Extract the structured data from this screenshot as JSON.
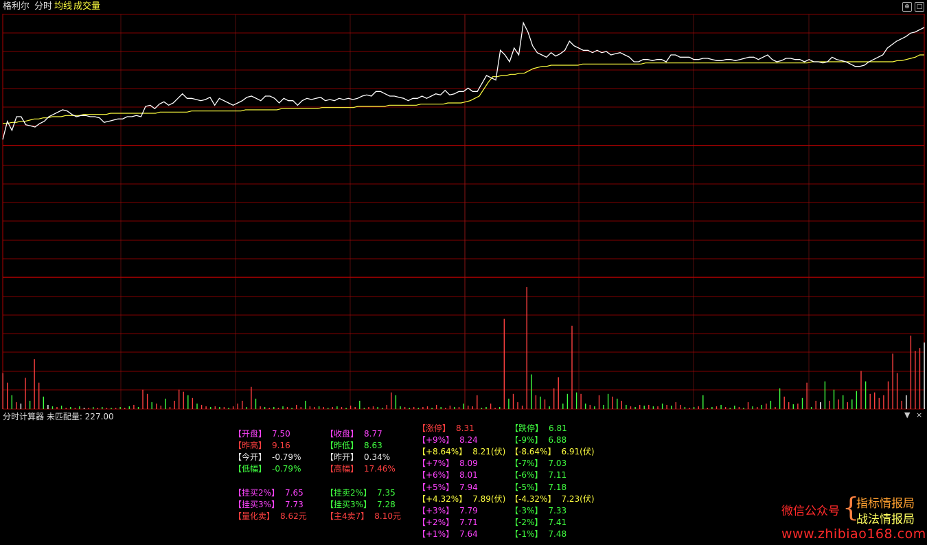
{
  "header": {
    "stock_name": "格利尔",
    "mode": "分时",
    "indicators": [
      "均线",
      "成交量"
    ]
  },
  "window_controls": [
    "⊕",
    "□"
  ],
  "colors": {
    "grid": "#b00000",
    "price_line": "#ffffff",
    "avg_line": "#ffff40",
    "up_bar": "#ff4040",
    "down_bar": "#40ff40",
    "flat_bar": "#ffffff"
  },
  "calculator": {
    "title": "分时计算器 未匹配量: 227.00",
    "block1": {
      "left": [
        {
          "k": "【开盘】",
          "v": "7.50",
          "c": "mag",
          "vc": "mag"
        },
        {
          "k": "【昨高】",
          "v": "9.16",
          "c": "red",
          "vc": "red"
        },
        {
          "k": "【今开】",
          "v": "-0.79%",
          "c": "wht",
          "vc": "wht"
        },
        {
          "k": "【低幅】",
          "v": "-0.79%",
          "c": "grn",
          "vc": "grn"
        }
      ],
      "right": [
        {
          "k": "【收盘】",
          "v": "8.77",
          "c": "mag",
          "vc": "mag"
        },
        {
          "k": "【昨低】",
          "v": "8.63",
          "c": "grn",
          "vc": "grn"
        },
        {
          "k": "【昨开】",
          "v": "0.34%",
          "c": "wht",
          "vc": "wht"
        },
        {
          "k": "【高幅】",
          "v": "17.46%",
          "c": "red",
          "vc": "red"
        }
      ]
    },
    "block2": {
      "left": [
        {
          "k": "【挂买2%】",
          "v": "7.65",
          "c": "mag",
          "vc": "mag"
        },
        {
          "k": "【挂买3%】",
          "v": "7.73",
          "c": "mag",
          "vc": "mag"
        },
        {
          "k": "【量化卖】",
          "v": "8.62元",
          "c": "red",
          "vc": "red"
        }
      ],
      "right": [
        {
          "k": "【挂卖2%】",
          "v": "7.35",
          "c": "grn",
          "vc": "grn"
        },
        {
          "k": "【挂买3%】",
          "v": "7.28",
          "c": "grn",
          "vc": "grn"
        },
        {
          "k": "【主4卖7】",
          "v": "8.10元",
          "c": "red",
          "vc": "red"
        }
      ]
    },
    "up_levels": [
      {
        "k": "【涨停】",
        "v": "8.31",
        "c": "red",
        "vc": "red"
      },
      {
        "k": "【+9%】",
        "v": "8.24",
        "c": "mag",
        "vc": "mag"
      },
      {
        "k": "【+8.64%】",
        "v": "8.21(伏)",
        "c": "yel",
        "vc": "yel"
      },
      {
        "k": "【+7%】",
        "v": "8.09",
        "c": "mag",
        "vc": "mag"
      },
      {
        "k": "【+6%】",
        "v": "8.01",
        "c": "mag",
        "vc": "mag"
      },
      {
        "k": "【+5%】",
        "v": "7.94",
        "c": "mag",
        "vc": "mag"
      },
      {
        "k": "【+4.32%】",
        "v": "7.89(伏)",
        "c": "yel",
        "vc": "yel"
      },
      {
        "k": "【+3%】",
        "v": "7.79",
        "c": "mag",
        "vc": "mag"
      },
      {
        "k": "【+2%】",
        "v": "7.71",
        "c": "mag",
        "vc": "mag"
      },
      {
        "k": "【+1%】",
        "v": "7.64",
        "c": "mag",
        "vc": "mag"
      }
    ],
    "down_levels": [
      {
        "k": "【跌停】",
        "v": "6.81",
        "c": "grn",
        "vc": "grn"
      },
      {
        "k": "【-9%】",
        "v": "6.88",
        "c": "grn",
        "vc": "grn"
      },
      {
        "k": "【-8.64%】",
        "v": "6.91(伏)",
        "c": "yel",
        "vc": "yel"
      },
      {
        "k": "【-7%】",
        "v": "7.03",
        "c": "grn",
        "vc": "grn"
      },
      {
        "k": "【-6%】",
        "v": "7.11",
        "c": "grn",
        "vc": "grn"
      },
      {
        "k": "【-5%】",
        "v": "7.18",
        "c": "grn",
        "vc": "grn"
      },
      {
        "k": "【-4.32%】",
        "v": "7.23(伏)",
        "c": "yel",
        "vc": "yel"
      },
      {
        "k": "【-3%】",
        "v": "7.33",
        "c": "grn",
        "vc": "grn"
      },
      {
        "k": "【-2%】",
        "v": "7.41",
        "c": "grn",
        "vc": "grn"
      },
      {
        "k": "【-1%】",
        "v": "7.48",
        "c": "grn",
        "vc": "grn"
      }
    ],
    "controls": [
      "▼",
      "×"
    ]
  },
  "watermark": {
    "wechat": "微信公众号",
    "brace": "{",
    "line1": "指标情报局",
    "line2": "战法情报局",
    "url": "www.zhibiao168.com"
  },
  "chart_data": {
    "type": "line",
    "series": [
      {
        "values": [
          7.5,
          7.66,
          7.58,
          7.7,
          7.7,
          7.63,
          7.62,
          7.61,
          7.64,
          7.66,
          7.7,
          7.72,
          7.74,
          7.76,
          7.75,
          7.72,
          7.7,
          7.71,
          7.71,
          7.7,
          7.7,
          7.69,
          7.65,
          7.66,
          7.67,
          7.68,
          7.68,
          7.7,
          7.7,
          7.71,
          7.7,
          7.79,
          7.8,
          7.77,
          7.81,
          7.83,
          7.8,
          7.82,
          7.86,
          7.9,
          7.86,
          7.86,
          7.85,
          7.84,
          7.85,
          7.87,
          7.8,
          7.86,
          7.84,
          7.82,
          7.8,
          7.82,
          7.84,
          7.87,
          7.88,
          7.86,
          7.84,
          7.88,
          7.88,
          7.86,
          7.82,
          7.86,
          7.84,
          7.84,
          7.8,
          7.84,
          7.86,
          7.85,
          7.86,
          7.87,
          7.84,
          7.85,
          7.84,
          7.86,
          7.85,
          7.86,
          7.85,
          7.86,
          7.88,
          7.89,
          7.88,
          7.92,
          7.92,
          7.9,
          7.88,
          7.88,
          7.87,
          7.86,
          7.84,
          7.86,
          7.86,
          7.88,
          7.86,
          7.88,
          7.9,
          7.89,
          7.93,
          7.89,
          7.9,
          7.92,
          7.92,
          7.95,
          7.92,
          7.92,
          7.99,
          8.06,
          8.04,
          8.02,
          8.28,
          8.24,
          8.18,
          8.3,
          8.24,
          8.52,
          8.44,
          8.32,
          8.26,
          8.24,
          8.22,
          8.26,
          8.23,
          8.25,
          8.28,
          8.36,
          8.32,
          8.3,
          8.28,
          8.28,
          8.26,
          8.28,
          8.26,
          8.27,
          8.24,
          8.25,
          8.26,
          8.24,
          8.22,
          8.18,
          8.18,
          8.2,
          8.2,
          8.19,
          8.2,
          8.2,
          8.18,
          8.24,
          8.24,
          8.22,
          8.22,
          8.22,
          8.2,
          8.2,
          8.21,
          8.21,
          8.2,
          8.19,
          8.19,
          8.2,
          8.2,
          8.19,
          8.2,
          8.21,
          8.22,
          8.22,
          8.2,
          8.22,
          8.24,
          8.2,
          8.18,
          8.19,
          8.21,
          8.21,
          8.2,
          8.2,
          8.18,
          8.2,
          8.18,
          8.18,
          8.17,
          8.18,
          8.22,
          8.2,
          8.19,
          8.18,
          8.16,
          8.14,
          8.14,
          8.15,
          8.18,
          8.2,
          8.22,
          8.24,
          8.3,
          8.33,
          8.36,
          8.38,
          8.4,
          8.43,
          8.44,
          8.46,
          8.48
        ]
      },
      {
        "values": [
          7.64,
          7.64,
          7.65,
          7.65,
          7.66,
          7.66,
          7.67,
          7.68,
          7.68,
          7.69,
          7.69,
          7.7,
          7.7,
          7.7,
          7.71,
          7.71,
          7.71,
          7.71,
          7.72,
          7.72,
          7.72,
          7.72,
          7.72,
          7.72,
          7.73,
          7.73,
          7.73,
          7.73,
          7.73,
          7.73,
          7.73,
          7.73,
          7.73,
          7.73,
          7.73,
          7.74,
          7.74,
          7.74,
          7.74,
          7.74,
          7.74,
          7.74,
          7.75,
          7.75,
          7.75,
          7.75,
          7.75,
          7.75,
          7.75,
          7.75,
          7.75,
          7.75,
          7.75,
          7.75,
          7.76,
          7.76,
          7.76,
          7.76,
          7.76,
          7.76,
          7.76,
          7.76,
          7.77,
          7.77,
          7.77,
          7.77,
          7.77,
          7.77,
          7.77,
          7.77,
          7.77,
          7.78,
          7.78,
          7.78,
          7.78,
          7.78,
          7.78,
          7.78,
          7.78,
          7.79,
          7.79,
          7.79,
          7.79,
          7.79,
          7.79,
          7.79,
          7.8,
          7.8,
          7.8,
          7.8,
          7.8,
          7.8,
          7.8,
          7.81,
          7.81,
          7.81,
          7.81,
          7.81,
          7.81,
          7.82,
          7.82,
          7.82,
          7.82,
          7.83,
          7.84,
          7.86,
          7.88,
          7.94,
          8.0,
          8.05,
          8.05,
          8.06,
          8.06,
          8.07,
          8.07,
          8.08,
          8.08,
          8.1,
          8.12,
          8.13,
          8.14,
          8.14,
          8.15,
          8.15,
          8.15,
          8.15,
          8.15,
          8.15,
          8.15,
          8.16,
          8.16,
          8.16,
          8.16,
          8.16,
          8.16,
          8.16,
          8.16,
          8.16,
          8.16,
          8.16,
          8.16,
          8.16,
          8.16,
          8.17,
          8.17,
          8.17,
          8.17,
          8.17,
          8.17,
          8.17,
          8.17,
          8.17,
          8.17,
          8.17,
          8.17,
          8.17,
          8.17,
          8.17,
          8.17,
          8.17,
          8.17,
          8.17,
          8.17,
          8.17,
          8.17,
          8.17,
          8.17,
          8.17,
          8.17,
          8.17,
          8.17,
          8.17,
          8.17,
          8.17,
          8.17,
          8.17,
          8.17,
          8.17,
          8.17,
          8.17,
          8.18,
          8.18,
          8.18,
          8.18,
          8.18,
          8.18,
          8.18,
          8.18,
          8.18,
          8.18,
          8.18,
          8.18,
          8.18,
          8.18,
          8.18,
          8.18,
          8.18,
          8.18,
          8.18,
          8.19,
          8.19,
          8.2,
          8.21,
          8.22,
          8.24,
          8.24
        ]
      }
    ],
    "ylim": [
      7.4,
      8.6
    ],
    "volume": {
      "values": [
        52,
        38,
        20,
        10,
        8,
        45,
        12,
        72,
        38,
        18,
        6,
        4,
        3,
        5,
        2,
        3,
        2,
        4,
        2,
        2,
        3,
        2,
        3,
        2,
        2,
        2,
        3,
        2,
        4,
        6,
        3,
        28,
        22,
        10,
        8,
        5,
        15,
        3,
        12,
        28,
        25,
        20,
        16,
        8,
        6,
        4,
        3,
        4,
        3,
        3,
        2,
        4,
        8,
        12,
        3,
        32,
        15,
        4,
        3,
        2,
        3,
        2,
        4,
        3,
        2,
        6,
        3,
        12,
        4,
        3,
        4,
        3,
        2,
        3,
        4,
        3,
        2,
        5,
        3,
        12,
        2,
        3,
        4,
        3,
        2,
        6,
        24,
        20,
        4,
        3,
        2,
        3,
        2,
        3,
        4,
        2,
        6,
        3,
        2,
        5,
        3,
        3,
        8,
        5,
        4,
        20,
        2,
        3,
        8,
        2,
        3,
        130,
        15,
        22,
        10,
        5,
        176,
        50,
        20,
        18,
        14,
        4,
        30,
        46,
        8,
        22,
        120,
        24,
        22,
        8,
        6,
        4,
        20,
        6,
        22,
        18,
        15,
        12,
        6,
        4,
        3,
        6,
        5,
        6,
        4,
        4,
        8,
        6,
        5,
        10,
        6,
        3,
        2,
        3,
        4,
        20,
        2,
        3,
        4,
        6,
        3,
        2,
        5,
        3,
        2,
        10,
        4,
        3,
        6,
        8,
        12,
        3,
        30,
        18,
        10,
        7,
        8,
        16,
        38,
        3,
        12,
        10,
        40,
        12,
        28,
        14,
        20,
        10,
        14,
        26,
        55,
        40,
        22,
        24,
        16,
        20,
        40,
        80,
        52,
        12,
        20,
        106,
        84,
        88,
        96
      ],
      "directions": [
        "u",
        "u",
        "d",
        "u",
        "f",
        "u",
        "d",
        "u",
        "u",
        "d",
        "f",
        "d",
        "u",
        "d",
        "u",
        "d",
        "u",
        "d",
        "f",
        "u",
        "d",
        "u",
        "d",
        "u",
        "d",
        "u",
        "d",
        "u",
        "d",
        "u",
        "d",
        "u",
        "u",
        "d",
        "u",
        "u",
        "d",
        "u",
        "u",
        "u",
        "u",
        "d",
        "u",
        "d",
        "u",
        "u",
        "d",
        "u",
        "d",
        "u",
        "d",
        "u",
        "u",
        "u",
        "d",
        "u",
        "d",
        "u",
        "d",
        "u",
        "d",
        "u",
        "d",
        "u",
        "d",
        "u",
        "u",
        "d",
        "u",
        "u",
        "d",
        "u",
        "d",
        "u",
        "d",
        "u",
        "d",
        "u",
        "u",
        "d",
        "d",
        "u",
        "u",
        "d",
        "d",
        "u",
        "u",
        "d",
        "d",
        "u",
        "d",
        "u",
        "d",
        "u",
        "u",
        "d",
        "u",
        "d",
        "u",
        "u",
        "d",
        "u",
        "d",
        "u",
        "u",
        "u",
        "d",
        "d",
        "u",
        "u",
        "d",
        "u",
        "d",
        "u",
        "u",
        "u",
        "u",
        "d",
        "u",
        "d",
        "u",
        "d",
        "u",
        "u",
        "d",
        "d",
        "u",
        "d",
        "u",
        "d",
        "u",
        "d",
        "u",
        "d",
        "d",
        "u",
        "d",
        "u",
        "d",
        "u",
        "d",
        "u",
        "d",
        "u",
        "d",
        "u",
        "d",
        "u",
        "d",
        "u",
        "u",
        "d",
        "u",
        "d",
        "u",
        "d",
        "u",
        "d",
        "u",
        "d",
        "u",
        "d",
        "d",
        "u",
        "d",
        "u",
        "d",
        "u",
        "d",
        "u",
        "d",
        "u",
        "d",
        "u",
        "u",
        "d",
        "u",
        "d",
        "u",
        "d",
        "u",
        "f",
        "d",
        "u",
        "d",
        "u",
        "d",
        "u",
        "d",
        "d",
        "u",
        "d",
        "u",
        "u",
        "u",
        "u",
        "u",
        "u",
        "u",
        "u",
        "f",
        "u",
        "u",
        "u",
        "f"
      ]
    }
  }
}
